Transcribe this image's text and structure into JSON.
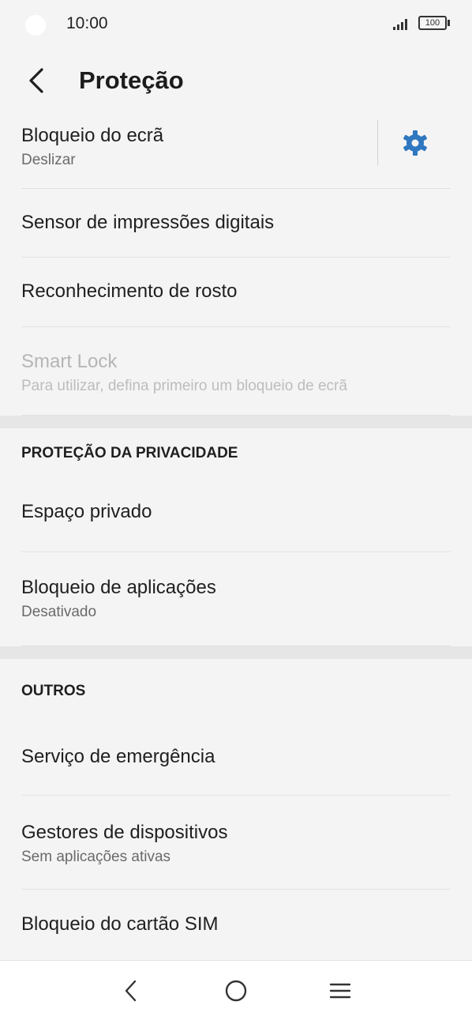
{
  "status_bar": {
    "time": "10:00",
    "battery": "100"
  },
  "header": {
    "title": "Proteção"
  },
  "items_top": [
    {
      "title": "Bloqueio do ecrã",
      "subtitle": "Deslizar"
    },
    {
      "title": "Sensor de impressões digitais"
    },
    {
      "title": "Reconhecimento de rosto"
    },
    {
      "title": "Smart Lock",
      "subtitle": "Para utilizar, defina primeiro um bloqueio de ecrã",
      "disabled": true
    }
  ],
  "privacy_section": {
    "header": "PROTEÇÃO DA PRIVACIDADE",
    "items": [
      {
        "title": "Espaço privado"
      },
      {
        "title": "Bloqueio de aplicações",
        "subtitle": "Desativado"
      }
    ]
  },
  "others_section": {
    "header": "OUTROS",
    "items": [
      {
        "title": "Serviço de emergência"
      },
      {
        "title": "Gestores de dispositivos",
        "subtitle": "Sem aplicações ativas"
      },
      {
        "title": "Bloqueio do cartão SIM"
      }
    ]
  },
  "icons": {
    "back": "chevron-left-icon",
    "settings": "gear-icon",
    "nav_back": "nav-back-icon",
    "nav_home": "nav-home-icon",
    "nav_menu": "nav-menu-icon"
  },
  "colors": {
    "accent": "#2f77c0",
    "background": "#f4f4f4",
    "section_gap": "#e6e6e6"
  }
}
